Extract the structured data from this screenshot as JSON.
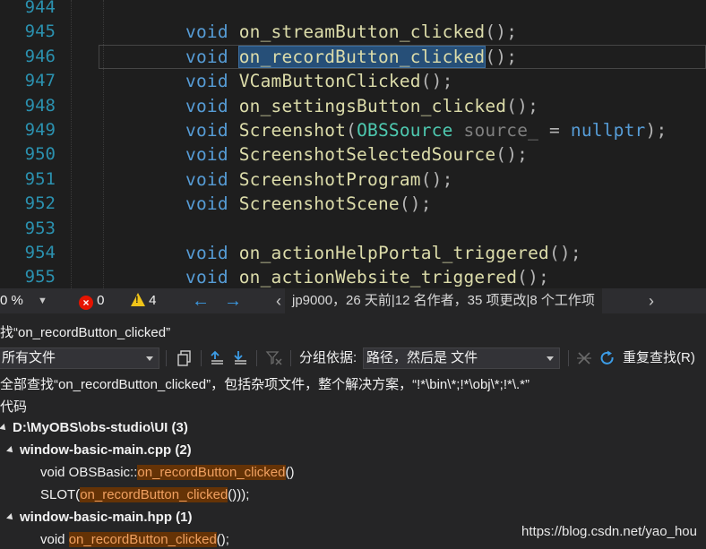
{
  "editor": {
    "lines": [
      {
        "num": "944",
        "tokens": []
      },
      {
        "num": "945",
        "tokens": [
          {
            "t": "void",
            "c": "kw"
          },
          {
            "t": " "
          },
          {
            "t": "on_streamButton_clicked",
            "c": "fn"
          },
          {
            "t": "();",
            "c": "pu"
          }
        ]
      },
      {
        "num": "946",
        "current": true,
        "tokens": [
          {
            "t": "void",
            "c": "kw"
          },
          {
            "t": " "
          },
          {
            "t": "on_recordButton_clicked",
            "c": "fn sel"
          },
          {
            "t": "();",
            "c": "pu"
          }
        ]
      },
      {
        "num": "947",
        "tokens": [
          {
            "t": "void",
            "c": "kw"
          },
          {
            "t": " "
          },
          {
            "t": "VCamButtonClicked",
            "c": "fn"
          },
          {
            "t": "();",
            "c": "pu"
          }
        ]
      },
      {
        "num": "948",
        "tokens": [
          {
            "t": "void",
            "c": "kw"
          },
          {
            "t": " "
          },
          {
            "t": "on_settingsButton_clicked",
            "c": "fn"
          },
          {
            "t": "();",
            "c": "pu"
          }
        ]
      },
      {
        "num": "949",
        "tokens": [
          {
            "t": "void",
            "c": "kw"
          },
          {
            "t": " "
          },
          {
            "t": "Screenshot",
            "c": "fn"
          },
          {
            "t": "(",
            "c": "pu"
          },
          {
            "t": "OBSSource",
            "c": "ty"
          },
          {
            "t": " "
          },
          {
            "t": "source_",
            "c": "pm"
          },
          {
            "t": " = ",
            "c": "pu"
          },
          {
            "t": "nullptr",
            "c": "nl"
          },
          {
            "t": ");",
            "c": "pu"
          }
        ]
      },
      {
        "num": "950",
        "tokens": [
          {
            "t": "void",
            "c": "kw"
          },
          {
            "t": " "
          },
          {
            "t": "ScreenshotSelectedSource",
            "c": "fn"
          },
          {
            "t": "();",
            "c": "pu"
          }
        ]
      },
      {
        "num": "951",
        "tokens": [
          {
            "t": "void",
            "c": "kw"
          },
          {
            "t": " "
          },
          {
            "t": "ScreenshotProgram",
            "c": "fn"
          },
          {
            "t": "();",
            "c": "pu"
          }
        ]
      },
      {
        "num": "952",
        "tokens": [
          {
            "t": "void",
            "c": "kw"
          },
          {
            "t": " "
          },
          {
            "t": "ScreenshotScene",
            "c": "fn"
          },
          {
            "t": "();",
            "c": "pu"
          }
        ]
      },
      {
        "num": "953",
        "tokens": []
      },
      {
        "num": "954",
        "tokens": [
          {
            "t": "void",
            "c": "kw"
          },
          {
            "t": " "
          },
          {
            "t": "on_actionHelpPortal_triggered",
            "c": "fn"
          },
          {
            "t": "();",
            "c": "pu"
          }
        ]
      },
      {
        "num": "955",
        "tokens": [
          {
            "t": "void",
            "c": "kw"
          },
          {
            "t": " "
          },
          {
            "t": "on_actionWebsite_triggered",
            "c": "fn"
          },
          {
            "t": "();",
            "c": "pu"
          }
        ]
      }
    ]
  },
  "status": {
    "zoom": "0 %",
    "errors": "0",
    "warnings": "4",
    "nav_back": "←",
    "nav_forward": "→",
    "git_info": "jp9000，26 天前|12 名作者，35 项更改|8 个工作项",
    "scroll_left": "‹",
    "scroll_right": "›"
  },
  "panel": {
    "title": "找“on_recordButton_clicked”",
    "scope_dropdown": "所有文件",
    "group_by_label": "分组依据:",
    "group_by_value": "路径，然后是 文件",
    "refind_label": "重复查找(R)",
    "summary": "全部查找“on_recordButton_clicked”，包括杂项文件，整个解决方案，“!*\\bin\\*;!*\\obj\\*;!*\\.*”",
    "category": "代码"
  },
  "results": {
    "folder": "D:\\MyOBS\\obs-studio\\UI (3)",
    "files": [
      {
        "name": "window-basic-main.cpp (2)",
        "matches": [
          {
            "pre": "void OBSBasic::",
            "hit": "on_recordButton_clicked",
            "post": "()"
          },
          {
            "pre": "SLOT(",
            "hit": "on_recordButton_clicked",
            "post": "()));"
          }
        ]
      },
      {
        "name": "window-basic-main.hpp (1)",
        "matches": [
          {
            "pre": "void ",
            "hit": "on_recordButton_clicked",
            "post": "();"
          }
        ]
      }
    ]
  },
  "watermark": "https://blog.csdn.net/yao_hou"
}
